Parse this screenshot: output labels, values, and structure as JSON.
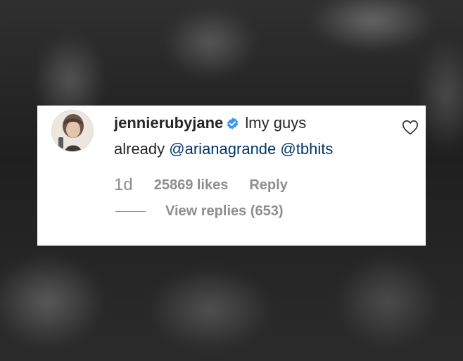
{
  "comment": {
    "username": "jennierubyjane",
    "text": "lmy guys already",
    "text_part1": "lmy guys",
    "text_part2": "already",
    "mentions": [
      "@arianagrande",
      "@tbhits"
    ],
    "verified_icon": "verified-badge-icon",
    "verified_color": "#3897f0",
    "mention_color": "#00376b"
  },
  "meta": {
    "time": "1d",
    "likes": "25869 likes",
    "reply_label": "Reply"
  },
  "replies": {
    "label": "View replies (653)"
  },
  "icons": {
    "like": "heart-outline-icon",
    "avatar": "profile-picture"
  }
}
